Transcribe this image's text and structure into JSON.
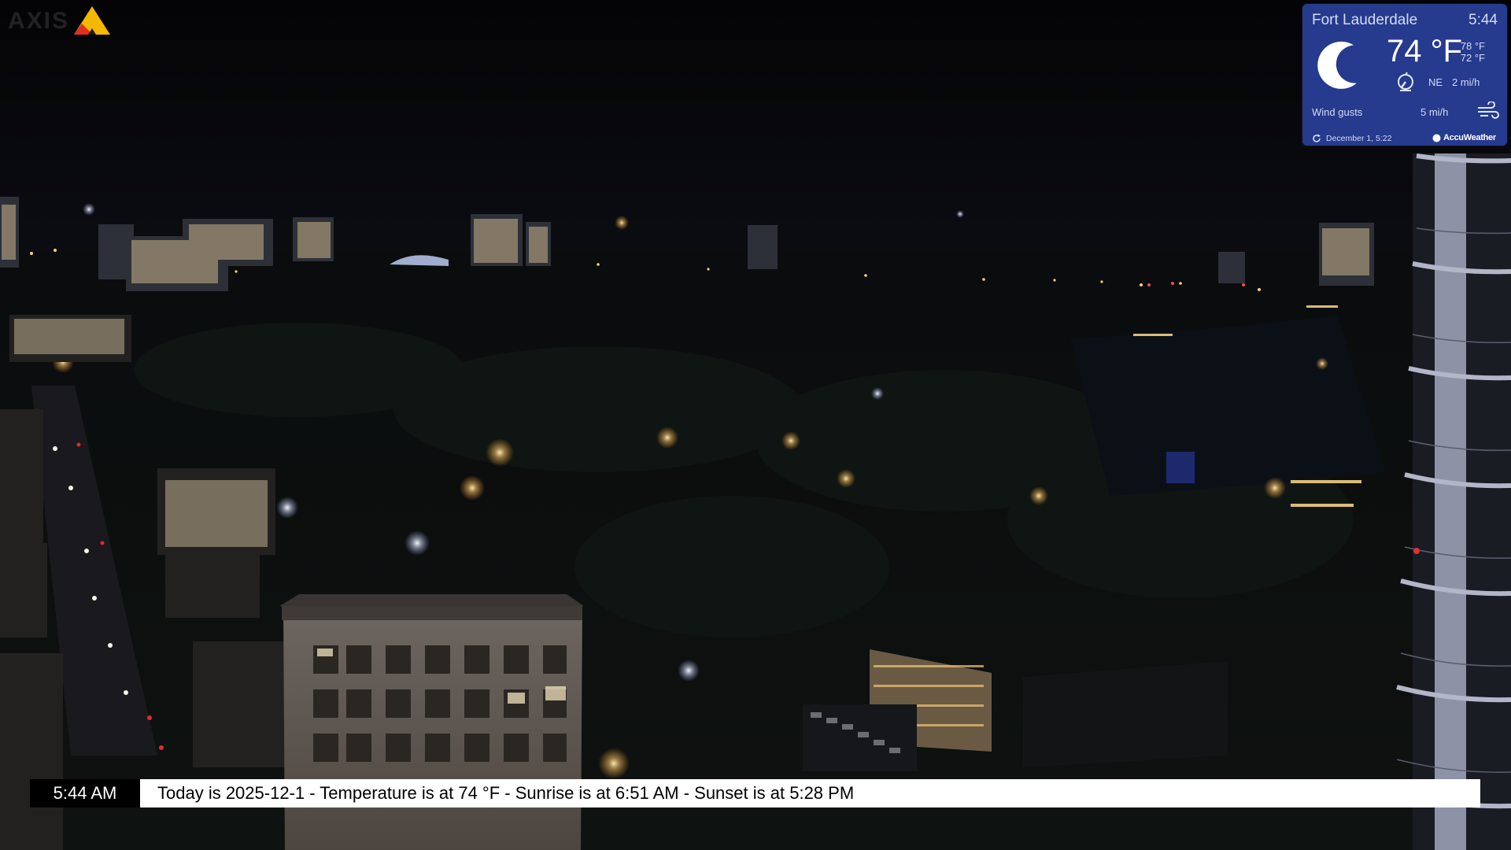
{
  "camera": {
    "brand": "AXIS",
    "brand_colors": {
      "triangle_top": "#f5b800",
      "triangle_left": "#e0301e"
    }
  },
  "weather": {
    "city": "Fort Lauderdale",
    "time": "5:44",
    "condition_icon": "moon-crescent-icon",
    "temperature": "74 °F",
    "high": "78 °F",
    "low": "72 °F",
    "wind_direction": "NE",
    "wind_speed": "2 mi/h",
    "wind_gusts_label": "Wind gusts",
    "wind_gusts": "5 mi/h",
    "updated": "December  1, 5:22",
    "provider": "AccuWeather",
    "background_color": "#263a8e"
  },
  "ticker": {
    "clock": "5:44 AM",
    "message": "Today is 2025-12-1 - Temperature is at  74 °F - Sunrise is at 6:51 AM - Sunset is at 5:28 PM"
  }
}
